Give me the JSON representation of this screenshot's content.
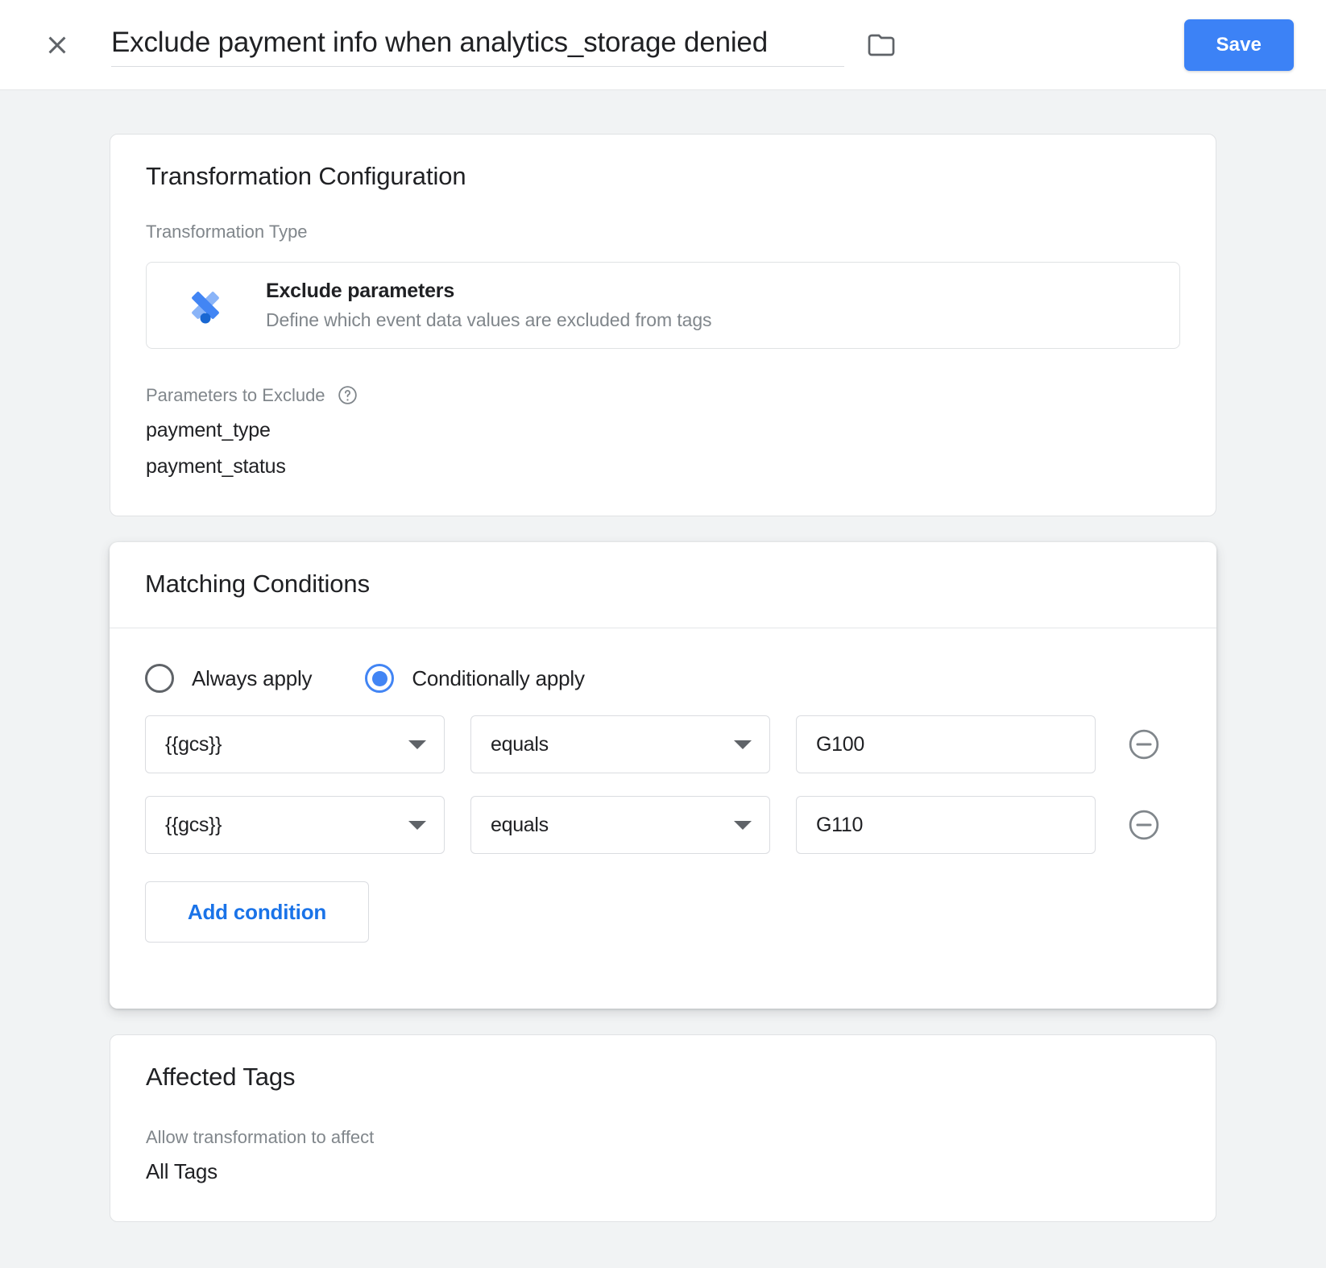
{
  "header": {
    "close_icon": "close-icon",
    "title_value": "Exclude payment info when analytics_storage denied",
    "title_placeholder": "Untitled Transformation",
    "folder_icon": "folder-icon",
    "save_label": "Save",
    "accent_color": "#3c82f6"
  },
  "transformation_card": {
    "title": "Transformation Configuration",
    "type_label": "Transformation Type",
    "type_tile": {
      "icon": "google-tag-manager-diamond-icon",
      "name": "Exclude parameters",
      "description": "Define which event data values are excluded from tags"
    },
    "params_label": "Parameters to Exclude",
    "help_icon": "help-circle-icon",
    "parameters": [
      "payment_type",
      "payment_status"
    ]
  },
  "matching_card": {
    "title": "Matching Conditions",
    "apply_options": [
      {
        "label": "Always apply",
        "selected": false
      },
      {
        "label": "Conditionally apply",
        "selected": true
      }
    ],
    "selected_color": "#4285f4",
    "conditions": [
      {
        "variable": "{{gcs}}",
        "operator": "equals",
        "value": "G100",
        "value_placeholder": "",
        "brick_icon": "variable-picker-brick-icon",
        "remove_icon": "remove-circle-icon"
      },
      {
        "variable": "{{gcs}}",
        "operator": "equals",
        "value": "G110",
        "value_placeholder": "",
        "brick_icon": "variable-picker-brick-icon",
        "remove_icon": "remove-circle-icon"
      }
    ],
    "add_condition_label": "Add condition",
    "add_condition_color": "#1a73e8"
  },
  "affected_card": {
    "title": "Affected Tags",
    "label": "Allow transformation to affect",
    "value": "All Tags"
  }
}
